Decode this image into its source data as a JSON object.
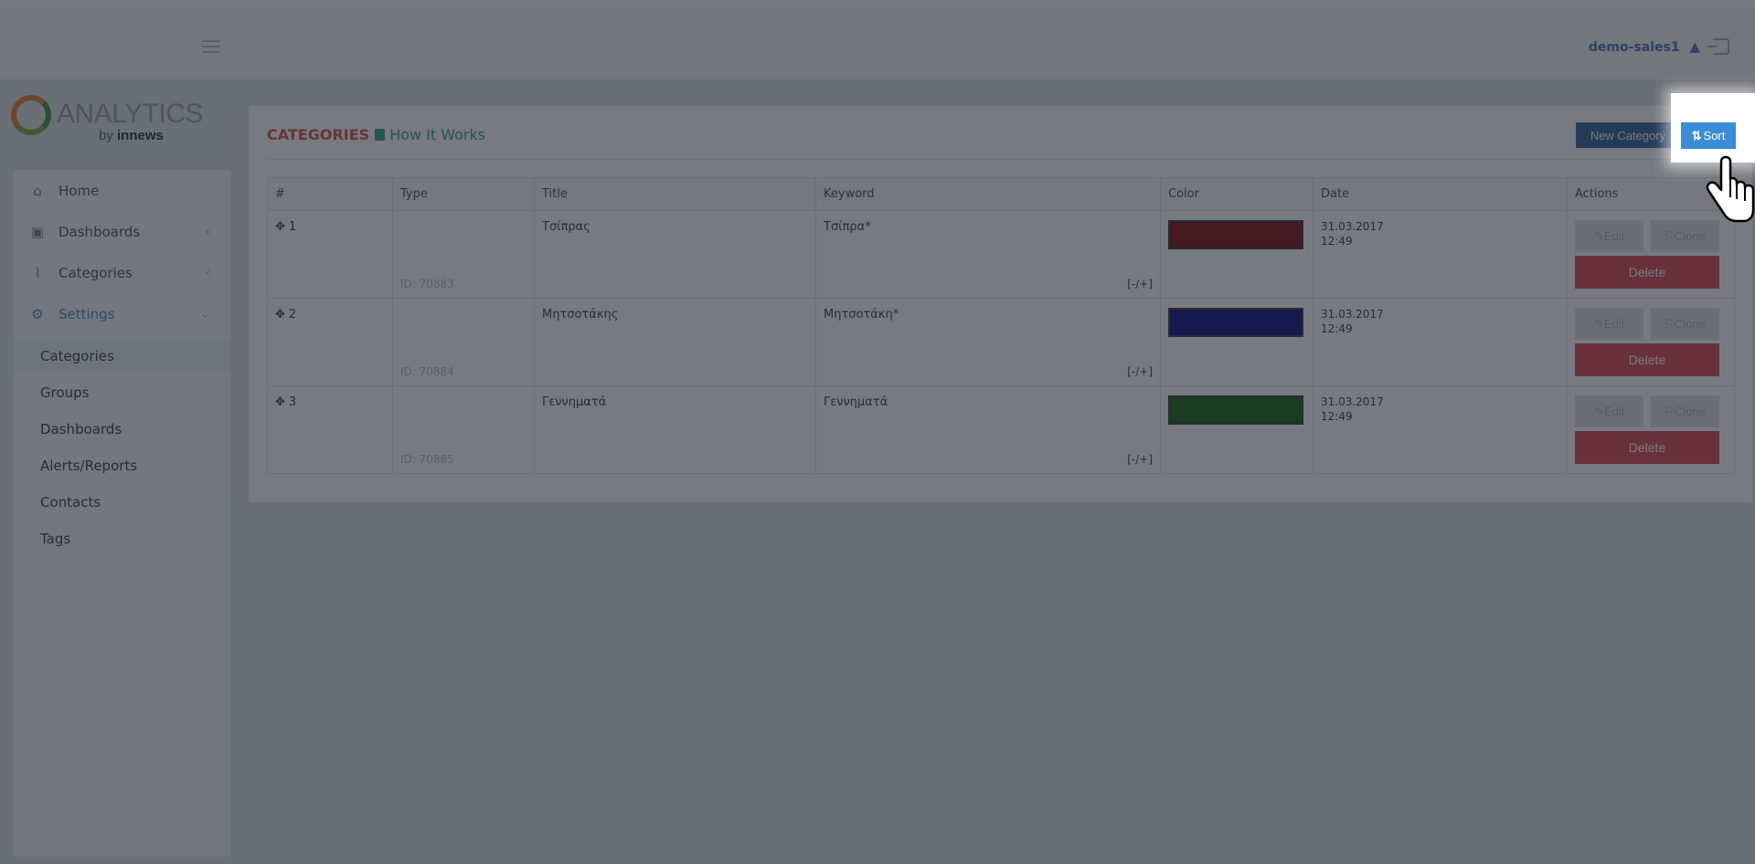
{
  "header": {
    "username": "demo-sales1",
    "warning_icon": "warning-icon",
    "logout_icon": "logout-icon"
  },
  "logo": {
    "text": "ANALYTICS",
    "sub_prefix": "by",
    "sub_brand": "innews"
  },
  "sidebar": {
    "items": [
      {
        "label": "Home",
        "icon": "home-icon"
      },
      {
        "label": "Dashboards",
        "icon": "dashboard-icon",
        "chevron": "‹"
      },
      {
        "label": "Categories",
        "icon": "paperclip-icon",
        "chevron": "‹"
      },
      {
        "label": "Settings",
        "icon": "gear-icon",
        "chevron": "⌄"
      }
    ],
    "settings_sub": [
      "Categories",
      "Groups",
      "Dashboards",
      "Alerts/Reports",
      "Contacts",
      "Tags"
    ]
  },
  "panel": {
    "title": "CATEGORIES",
    "how_it_works": "How It Works",
    "new_category": "New Category",
    "sort": "Sort"
  },
  "table": {
    "headers": [
      "#",
      "Type",
      "Title",
      "Keyword",
      "Color",
      "Date",
      "Actions"
    ],
    "rows": [
      {
        "num": "1",
        "id": "ID: 70883",
        "title": "Τσίπρας",
        "keyword": "Τσίπρα*",
        "toggle": "[-/+]",
        "color": "#7a0000",
        "date": "31.03.2017",
        "time": "12:49"
      },
      {
        "num": "2",
        "id": "ID: 70884",
        "title": "Μητσοτάκης",
        "keyword": "Μητσοτάκη*",
        "toggle": "[-/+]",
        "color": "#00007a",
        "date": "31.03.2017",
        "time": "12:49"
      },
      {
        "num": "3",
        "id": "ID: 70885",
        "title": "Γεννηματά",
        "keyword": "Γεννηματά",
        "toggle": "[-/+]",
        "color": "#0a5e0a",
        "date": "31.03.2017",
        "time": "12:49"
      }
    ],
    "actions": {
      "edit": "Edit",
      "clone": "Clone",
      "delete": "Delete"
    }
  }
}
